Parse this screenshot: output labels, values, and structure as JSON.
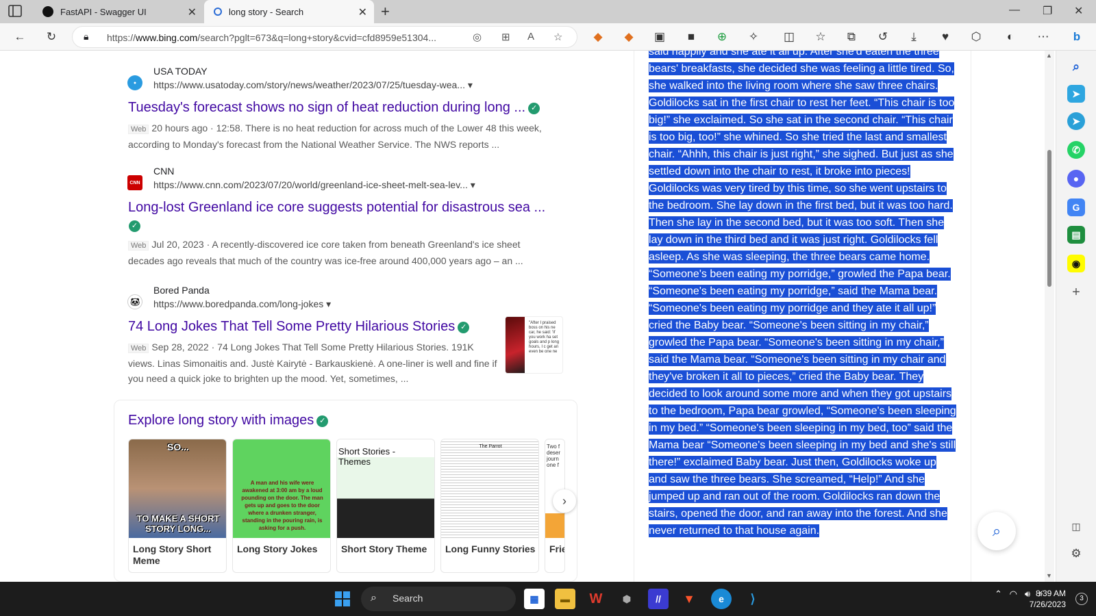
{
  "browser": {
    "tabs": [
      {
        "label": "FastAPI - Swagger UI",
        "active": false
      },
      {
        "label": "long story - Search",
        "active": true
      }
    ],
    "url_prefix": "https://",
    "url_domain": "www.bing.com",
    "url_rest": "/search?pglt=673&q=long+story&cvid=cfd8959e51304..."
  },
  "results": [
    {
      "source_name": "USA TODAY",
      "url": "https://www.usatoday.com/story/news/weather/2023/07/25/tuesday-wea...",
      "title": "Tuesday's forecast shows no sign of heat reduction during long ...",
      "web_tag": "Web",
      "snippet": "20 hours ago · 12:58. There is no heat reduction for across much of the Lower 48 this week, according to Monday's forecast from the National Weather Service. The NWS reports ..."
    },
    {
      "source_name": "CNN",
      "url": "https://www.cnn.com/2023/07/20/world/greenland-ice-sheet-melt-sea-lev...",
      "title": "Long-lost Greenland ice core suggests potential for disastrous sea ...",
      "web_tag": "Web",
      "snippet": "Jul 20, 2023 · A recently-discovered ice core taken from beneath Greenland's ice sheet decades ago reveals that much of the country was ice-free around 400,000 years ago – an ..."
    },
    {
      "source_name": "Bored Panda",
      "url": "https://www.boredpanda.com/long-jokes",
      "title": "74 Long Jokes That Tell Some Pretty Hilarious Stories",
      "web_tag": "Web",
      "snippet": "Sep 28, 2022 · 74 Long Jokes That Tell Some Pretty Hilarious Stories. 191K views. Linas Simonaitis and. Justė Kairytė - Barkauskienė. A one-liner is well and fine if you need a quick joke to brighten up the mood. Yet, sometimes, ...",
      "thumb_text": "\"After I praised boss on his ne car, he said: 'If you work ha set goals and p long hours, I c get an even be one ne"
    }
  ],
  "image_section": {
    "heading": "Explore long story with images",
    "tiles": [
      {
        "caption": "Long Story Short Meme",
        "overlay_top": "SO...",
        "overlay_bottom": "TO MAKE A SHORT STORY LONG..."
      },
      {
        "caption": "Long Story Jokes",
        "overlay_bottom": "A man and his wife were awakened at 3:00 am by a loud pounding on the door. The man gets up and goes to the door where a drunken stranger, standing in the pouring rain, is asking for a push."
      },
      {
        "caption": "Short Story Theme",
        "overlay_top": "Short Stories - Themes"
      },
      {
        "caption": "Long Funny Stories",
        "overlay_top": "The Parrot"
      },
      {
        "caption": "Frie",
        "overlay_top": "Two f deser journ one f"
      }
    ]
  },
  "story": {
    "text": "said happily and she ate it all up. After she'd eaten the three bears' breakfasts, she decided she was feeling a little tired. So, she walked into the living room where she saw three chairs. Goldilocks sat in the first chair to rest her feet. “This chair is too big!” she exclaimed. So she sat in the second chair. “This chair is too big, too!” she whined. So she tried the last and smallest chair. “Ahhh, this chair is just right,” she sighed. But just as she settled down into the chair to rest, it broke into pieces! Goldilocks was very tired by this time, so she went upstairs to the bedroom. She lay down in the first bed, but it was too hard. Then she lay in the second bed, but it was too soft. Then she lay down in the third bed and it was just right. Goldilocks fell asleep. As she was sleeping, the three bears came home. “Someone's been eating my porridge,” growled the Papa bear. “Someone's been eating my porridge,” said the Mama bear. “Someone's been eating my porridge and they ate it all up!” cried the Baby bear. “Someone's been sitting in my chair,” growled the Papa bear. “Someone's been sitting in my chair,” said the Mama bear. “Someone's been sitting in my chair and they've broken it all to pieces,” cried the Baby bear. They decided to look around some more and when they got upstairs to the bedroom, Papa bear growled, “Someone's been sleeping in my bed.” “Someone's been sleeping in my bed, too” said the Mama bear “Someone's been sleeping in my bed and she's still there!” exclaimed Baby bear. Just then, Goldilocks woke up and saw the three bears. She screamed, “Help!” And she jumped up and ran out of the room. Goldilocks ran down the stairs, opened the door, and ran away into the forest. And she never returned to that house again."
  },
  "taskbar": {
    "search_label": "Search",
    "time": "8:39 AM",
    "date": "7/26/2023",
    "notification_count": "3"
  },
  "colors": {
    "link": "#4007a2",
    "highlight": "#1a4fd6",
    "verified": "#239b6f"
  }
}
